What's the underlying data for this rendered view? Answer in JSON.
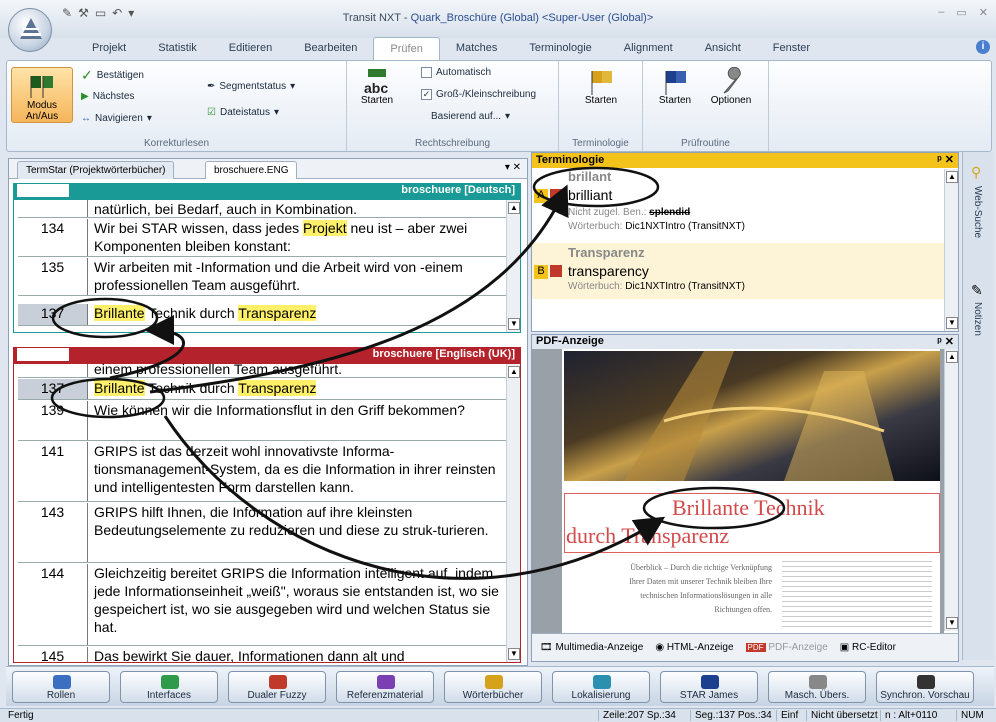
{
  "window": {
    "title_prefix": "Transit NXT - ",
    "title_project": "Quark_Broschüre (Global) <Super-User (Global)>"
  },
  "ribbon_tabs": [
    "Projekt",
    "Statistik",
    "Editieren",
    "Bearbeiten",
    "Prüfen",
    "Matches",
    "Terminologie",
    "Alignment",
    "Ansicht",
    "Fenster"
  ],
  "active_tab": "Prüfen",
  "ribbon": {
    "korrekturlesen": {
      "label": "Korrekturlesen",
      "modus": "Modus An/Aus",
      "bestaetigen": "Bestätigen",
      "naechstes": "Nächstes",
      "navigieren": "Navigieren",
      "segmentstatus": "Segmentstatus",
      "dateistatus": "Dateistatus"
    },
    "rechtschreibung": {
      "label": "Rechtschreibung",
      "starten": "Starten",
      "automatisch": "Automatisch",
      "gross_klein": "Groß-/Kleinschreibung",
      "basierend": "Basierend auf..."
    },
    "terminologie": {
      "label": "Terminologie",
      "starten": "Starten"
    },
    "pruefroutine": {
      "label": "Prüfroutine",
      "starten": "Starten",
      "optionen": "Optionen"
    }
  },
  "left_pane": {
    "tabs": [
      "TermStar (Projektwörterbücher)",
      "broschuere.ENG"
    ],
    "source_header": "broschuere [Deutsch]",
    "target_header": "broschuere [Englisch (UK)]",
    "source_rows": [
      {
        "num": "",
        "text": "natürlich, bei Bedarf, auch in Kombination."
      },
      {
        "num": "134",
        "pre": "Wir bei STAR wissen, dass jedes ",
        "hl": "Projekt",
        "post": " neu ist – aber zwei Komponenten bleiben konstant:"
      },
      {
        "num": "135",
        "text": "Wir arbeiten mit -Information und die Arbeit wird von -einem professionellen Team ausgeführt."
      },
      {
        "num": "137",
        "a": "Brillante",
        "b": " Technik durch ",
        "c": "Transparenz"
      }
    ],
    "target_rows": [
      {
        "num": "",
        "text": "einem professionellen Team ausgeführt."
      },
      {
        "num": "137",
        "a": "Brillante",
        "b": " Technik durch ",
        "c": "Transparenz"
      },
      {
        "num": "139",
        "text": "Wie können wir die Informationsflut in den Griff bekommen?"
      },
      {
        "num": "141",
        "text": "GRIPS ist das derzeit wohl innovativste Informa-tionsmanagement-System, da es die Information in ihrer reinsten und intelligentesten Form darstellen kann."
      },
      {
        "num": "143",
        "text": "GRIPS hilft Ihnen, die Information auf ihre kleinsten Bedeutungselemente zu reduzieren und diese zu struk-turieren."
      },
      {
        "num": "144",
        "text": "Gleichzeitig bereitet GRIPS die Information intelligent auf, indem jede Informationseinheit „weiß\", woraus sie entstanden ist, wo sie gespeichert ist, wo sie ausgegeben wird und welchen Status sie hat."
      },
      {
        "num": "145",
        "text": "Das bewirkt Sie dauer, Informationen dann alt und"
      }
    ]
  },
  "terminology": {
    "header": "Terminologie",
    "entries": [
      {
        "letter": "A",
        "source": "brillant",
        "target": "brilliant",
        "note_label": "Nicht zugel. Ben.:",
        "note_value": "splendid",
        "dict_label": "Wörterbuch:",
        "dict_value": "Dic1NXTIntro (TransitNXT)"
      },
      {
        "letter": "B",
        "source": "Transparenz",
        "target": "transparency",
        "dict_label": "Wörterbuch:",
        "dict_value": "Dic1NXTIntro (TransitNXT)"
      }
    ]
  },
  "pdf": {
    "header": "PDF-Anzeige",
    "heading_line1": "Brillante Technik",
    "heading_line2": "durch Transparenz",
    "body_lines": [
      "Überblick – Durch die richtige Verknüpfung",
      "Ihrer Daten mit unserer Technik bleiben Ihre",
      "technischen Informationslösungen in alle",
      "Richtungen offen."
    ],
    "tabs": [
      "Multimedia-Anzeige",
      "HTML-Anzeige",
      "PDF-Anzeige",
      "RC-Editor"
    ]
  },
  "sidebar": {
    "web_search": "Web-Suche",
    "notes": "Notizen"
  },
  "bottom_buttons": [
    "Rollen",
    "Interfaces",
    "Dualer Fuzzy",
    "Referenzmaterial",
    "Wörterbücher",
    "Lokalisierung",
    "STAR James",
    "Masch. Übers.",
    "Synchron. Vorschau"
  ],
  "status": {
    "left": "Fertig",
    "zeile": "Zeile:207 Sp.:34",
    "seg": "Seg.:137 Pos.:34",
    "einf": "Einf",
    "uebersetzt": "Nicht übersetzt",
    "shortcut": "n : Alt+0110",
    "num": "NUM"
  },
  "colors": {
    "source_header": "#1a9a97",
    "target_header": "#b4232b",
    "term_header": "#f3c21b",
    "highlight": "#fff06a",
    "pdf_heading": "#d24a4a"
  }
}
